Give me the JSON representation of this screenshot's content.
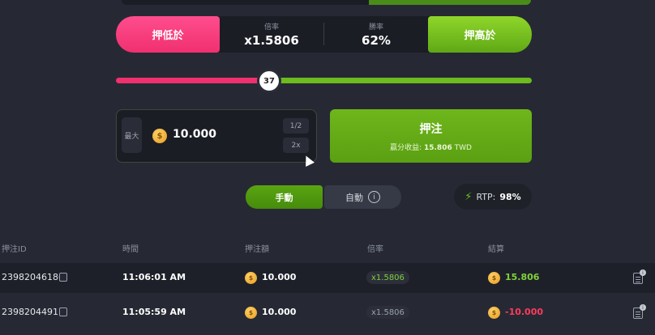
{
  "bet_bar": {
    "low_label": "押低於",
    "high_label": "押高於",
    "multiplier_label": "倍率",
    "multiplier_value": "x1.5806",
    "win_chance_label": "勝率",
    "win_chance_value": "62%"
  },
  "slider": {
    "value": "37"
  },
  "amount": {
    "max_label": "最大",
    "value": "10.000",
    "half_label": "1/2",
    "double_label": "2x",
    "coin_symbol": "$"
  },
  "place_bet": {
    "label": "押注",
    "profit_label": "贏分收益:",
    "profit_value": "15.806",
    "currency": "TWD"
  },
  "mode": {
    "manual_label": "手動",
    "auto_label": "自動"
  },
  "rtp": {
    "label": "RTP:",
    "value": "98%"
  },
  "table": {
    "headers": [
      "押注ID",
      "時間",
      "押注額",
      "倍率",
      "結算"
    ],
    "rows": [
      {
        "id": "23982046186",
        "time": "11:06:01 AM",
        "amount": "10.000",
        "multiplier": "x1.5806",
        "result": "15.806",
        "win": true
      },
      {
        "id": "23982044911",
        "time": "11:05:59 AM",
        "amount": "10.000",
        "multiplier": "x1.5806",
        "result": "-10.000",
        "win": false
      }
    ]
  },
  "colors": {
    "win": "#7fd13b",
    "loss": "#ff3b5c",
    "low": "#f0306f",
    "high": "#6dbb1c"
  }
}
